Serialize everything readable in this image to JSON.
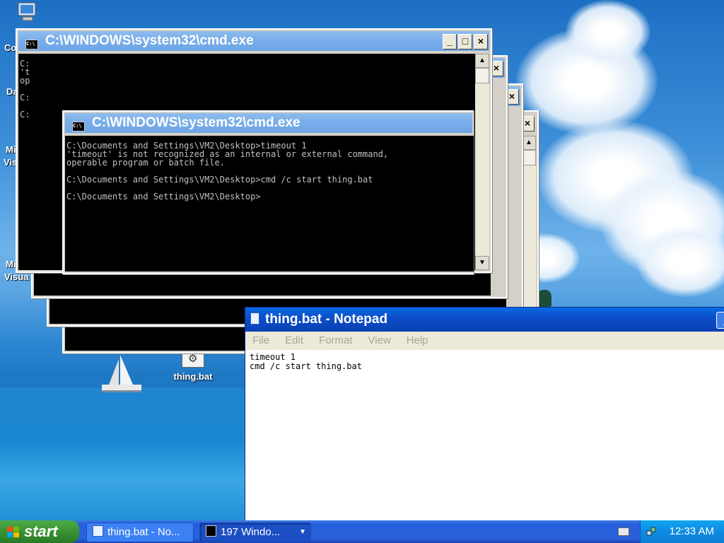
{
  "desktop": {
    "left_icon_labels": [
      "Co",
      "Da",
      "Mi",
      "Visu",
      "Mi",
      "Visua"
    ],
    "thing_icon_label": "thing.bat"
  },
  "cmd_windows": {
    "title": "C:\\WINDOWS\\system32\\cmd.exe",
    "icon_text": "C:\\",
    "partial_lines_1": [
      "C:",
      "'t",
      "op",
      "C:",
      "C:"
    ],
    "partial_lines_2": [
      "C:",
      "'t",
      "op",
      "C:",
      "C:"
    ],
    "partial_lines_3": [
      "C:",
      "'t",
      "op",
      "C:",
      "C:"
    ],
    "front_console": "C:\\Documents and Settings\\VM2\\Desktop>timeout 1\n'timeout' is not recognized as an internal or external command,\noperable program or batch file.\n\nC:\\Documents and Settings\\VM2\\Desktop>cmd /c start thing.bat\n\nC:\\Documents and Settings\\VM2\\Desktop>"
  },
  "notepad": {
    "title": "thing.bat - Notepad",
    "menu": [
      "File",
      "Edit",
      "Format",
      "View",
      "Help"
    ],
    "content": "timeout 1\ncmd /c start thing.bat"
  },
  "taskbar": {
    "start_label": "start",
    "buttons": [
      {
        "label": "thing.bat - No..."
      },
      {
        "label": "197 Windo..."
      }
    ],
    "clock": "12:33 AM"
  },
  "colors": {
    "cmd_title": "#79aeea",
    "notepad_title": "#0d4fc9",
    "taskbar": "#245edb",
    "start": "#37902f"
  }
}
